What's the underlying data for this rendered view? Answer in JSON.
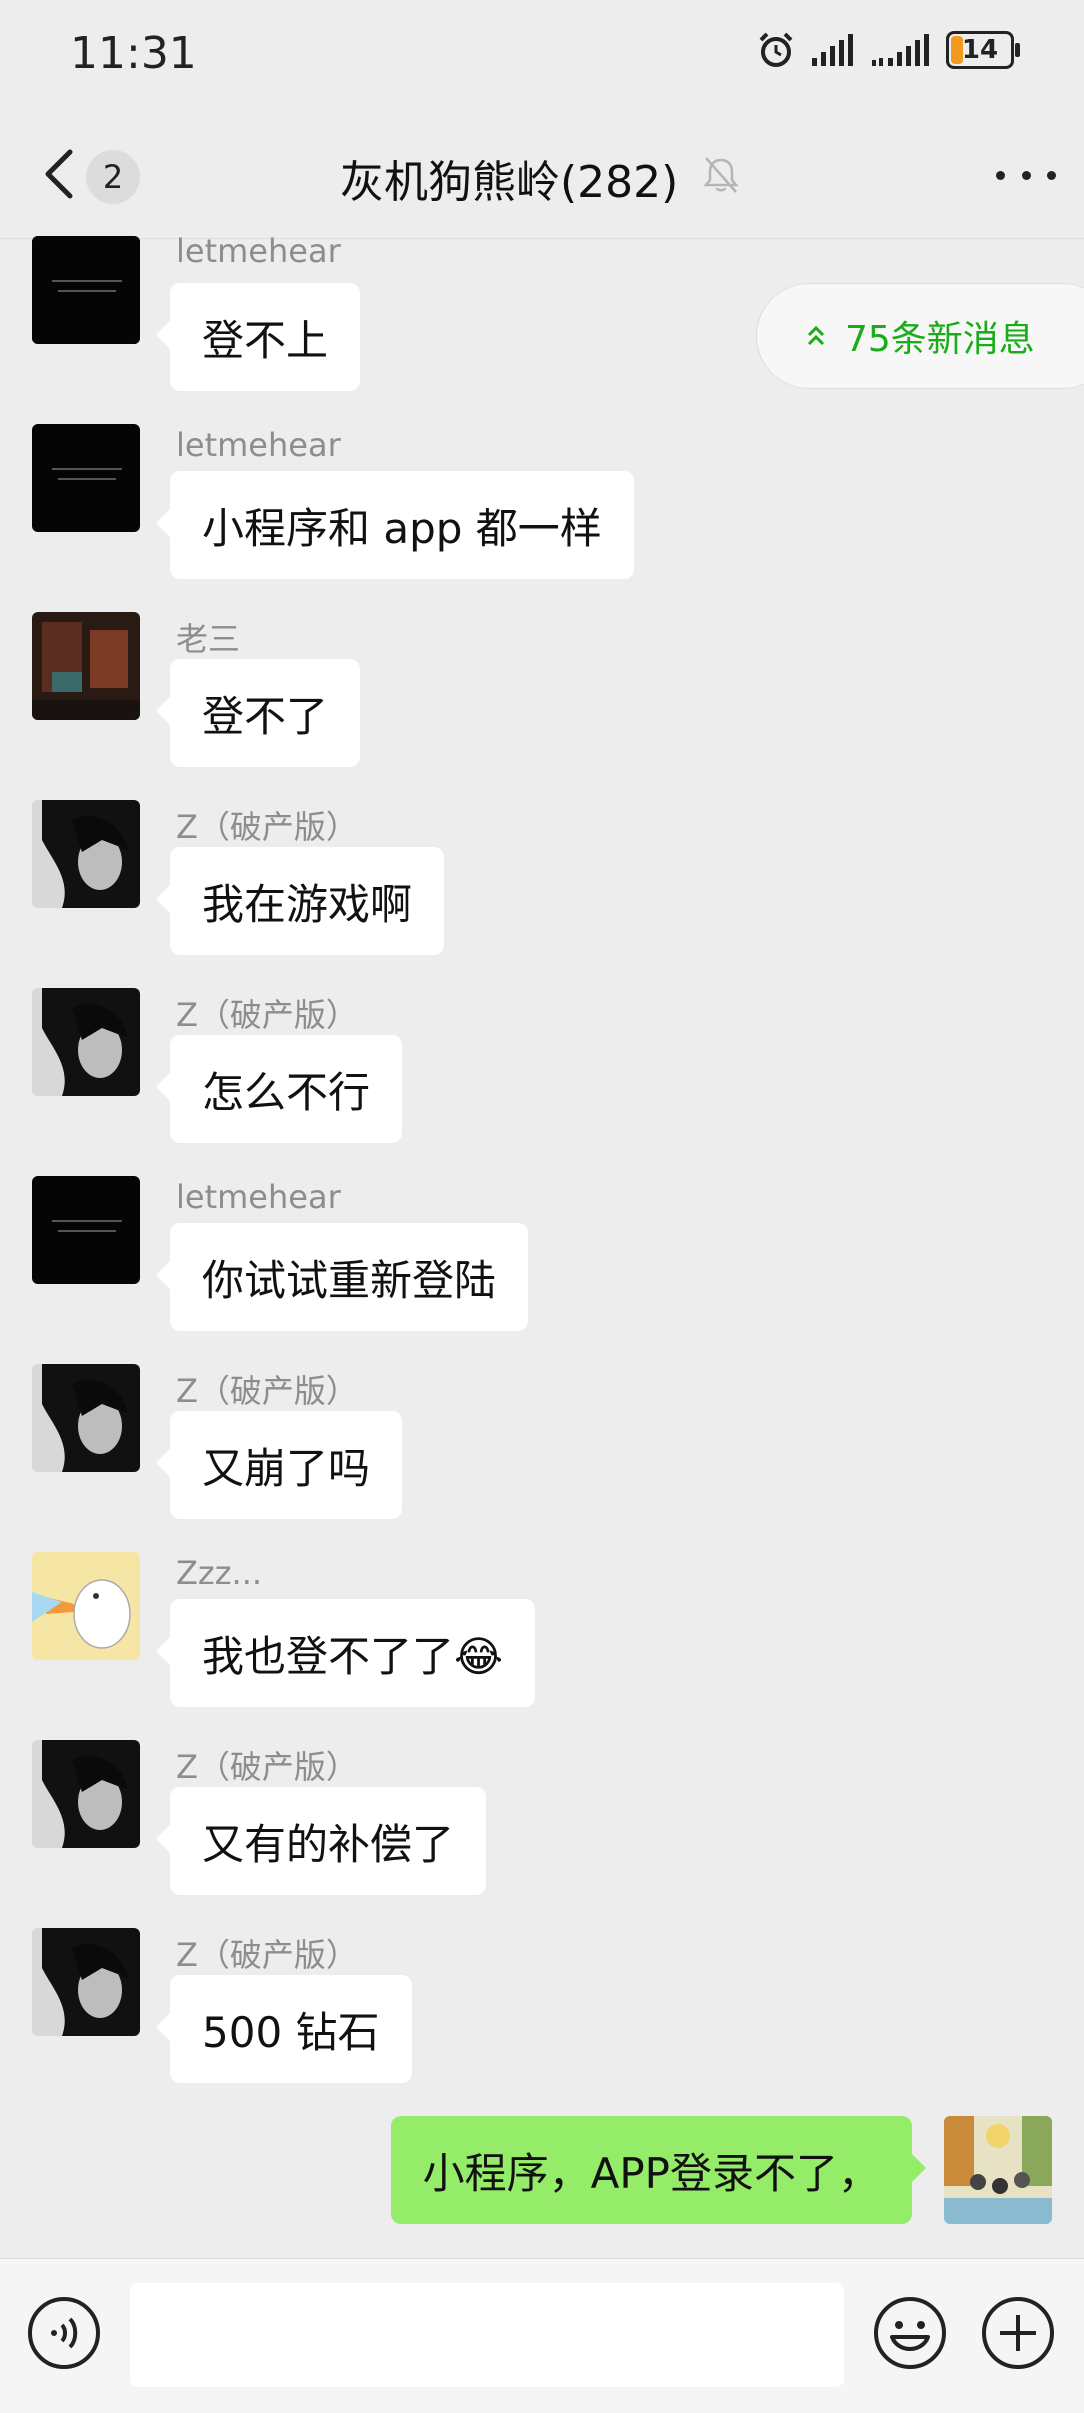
{
  "status_bar": {
    "time": "11:31",
    "battery": "14"
  },
  "nav": {
    "back_count": "2",
    "title": "灰机狗熊岭(282)"
  },
  "new_messages_pill": "75条新消息",
  "messages": [
    {
      "sender": "letmehear",
      "text": "登不上",
      "avatar": "black-text-avatar"
    },
    {
      "sender": "letmehear",
      "text": "小程序和 app 都一样",
      "avatar": "black-text-avatar"
    },
    {
      "sender": "老三",
      "text": "登不了",
      "avatar": "room-photo-avatar"
    },
    {
      "sender": "Z（破产版）",
      "text": "我在游戏啊",
      "avatar": "anime-boy-avatar"
    },
    {
      "sender": "Z（破产版）",
      "text": "怎么不行",
      "avatar": "anime-boy-avatar"
    },
    {
      "sender": "letmehear",
      "text": "你试试重新登陆",
      "avatar": "black-text-avatar"
    },
    {
      "sender": "Z（破产版）",
      "text": "又崩了吗",
      "avatar": "anime-boy-avatar"
    },
    {
      "sender": "Zzz...",
      "text": "我也登不了了😂",
      "avatar": "duck-avatar"
    },
    {
      "sender": "Z（破产版）",
      "text": "又有的补偿了",
      "avatar": "anime-boy-avatar"
    },
    {
      "sender": "Z（破产版）",
      "text": "500 钻石",
      "avatar": "anime-boy-avatar"
    }
  ],
  "self_message": {
    "text": "小程序，APP登录不了，",
    "avatar": "family-illustration-avatar"
  },
  "input": {
    "value": ""
  }
}
